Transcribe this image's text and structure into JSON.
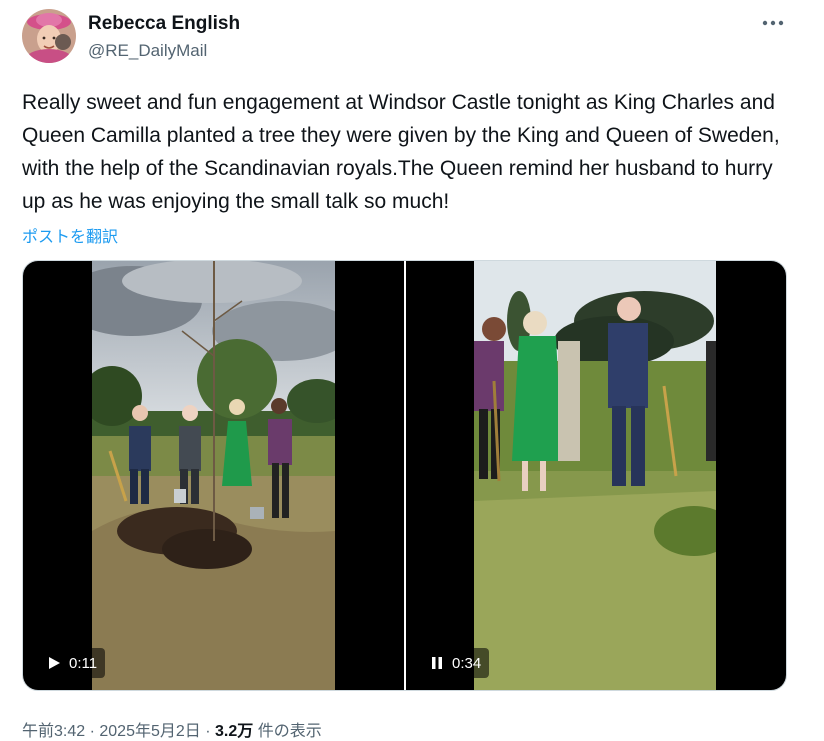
{
  "author": {
    "name": "Rebecca English",
    "handle": "@RE_DailyMail",
    "avatar_icon": "avatar-photo"
  },
  "header": {
    "more_icon": "more-horizontal-icon"
  },
  "tweet": {
    "text": "Really sweet and fun engagement at Windsor Castle tonight as King Charles and Queen Camilla planted a tree they were given by the King and Queen of Sweden, with the help of the Scandinavian royals.The Queen remind her husband to hurry up as he was enjoying the small talk so much!",
    "translate_label": "ポストを翻訳"
  },
  "media": {
    "videos": [
      {
        "time": "0:11",
        "control_icon": "play-icon",
        "state": "paused"
      },
      {
        "time": "0:34",
        "control_icon": "pause-icon",
        "state": "playing"
      }
    ]
  },
  "meta": {
    "time": "午前3:42",
    "separator": " · ",
    "date": "2025年5月2日",
    "separator2": " · ",
    "views_count": "3.2万",
    "views_label": " 件の表示"
  },
  "colors": {
    "link": "#1d9bf0",
    "secondary_text": "#536471",
    "primary_text": "#0f1419"
  }
}
